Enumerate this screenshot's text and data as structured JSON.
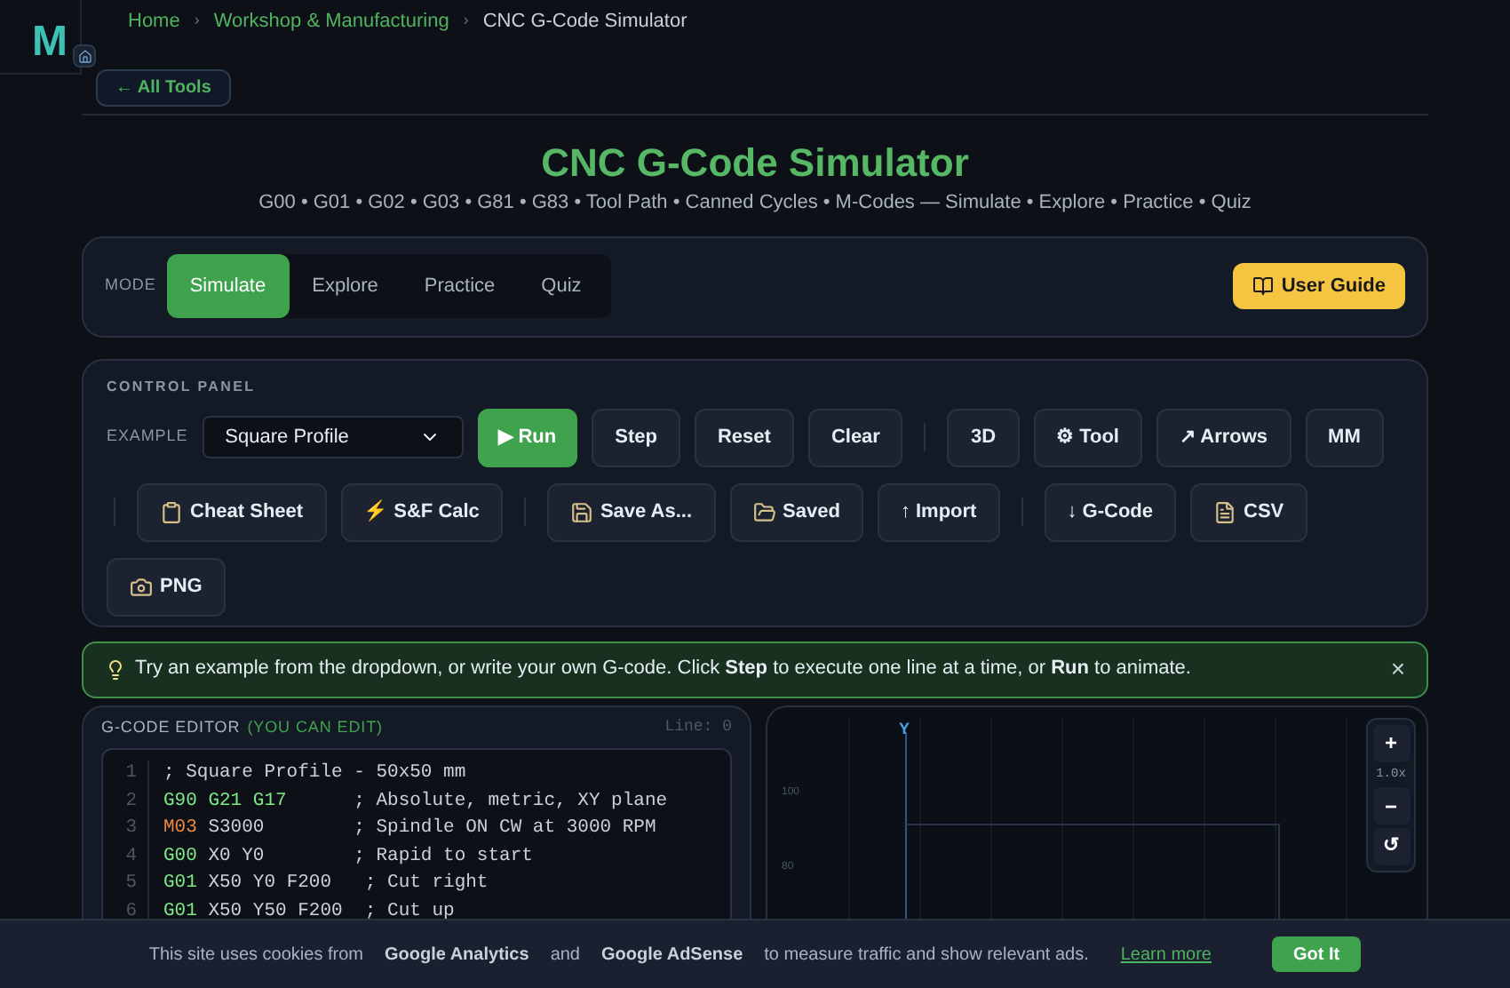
{
  "logo": {
    "letter": "M"
  },
  "breadcrumb": [
    {
      "label": "Home",
      "link": true
    },
    {
      "separator_before": "›",
      "label": "Workshop & Manufacturing",
      "link": true
    },
    {
      "separator_before": "›",
      "label": "CNC G-Code Simulator",
      "link": false
    }
  ],
  "back_button": "← All Tools",
  "title": "CNC G-Code Simulator",
  "subtitle": "G00 • G01 • G02 • G03 • G81 • G83 • Tool Path • Canned Cycles • M-Codes — Simulate • Explore • Practice • Quiz",
  "mode": {
    "label": "MODE",
    "tabs": [
      {
        "label": "Simulate",
        "selected": true
      },
      {
        "label": "Explore",
        "selected": false
      },
      {
        "label": "Practice",
        "selected": false
      },
      {
        "label": "Quiz",
        "selected": false
      }
    ],
    "guide_button": "User Guide"
  },
  "control_panel": {
    "title": "CONTROL PANEL",
    "example_label": "EXAMPLE",
    "example_value": "Square Profile",
    "items": [
      {
        "kind": "button",
        "label": "▶ Run",
        "primary": true
      },
      {
        "kind": "button",
        "label": "Step",
        "primary": false
      },
      {
        "kind": "button",
        "label": "Reset",
        "primary": false
      },
      {
        "kind": "button",
        "label": "Clear",
        "primary": false
      },
      {
        "kind": "divider"
      },
      {
        "kind": "button",
        "label": "3D",
        "primary": false
      },
      {
        "kind": "button",
        "label": "⚙ Tool",
        "primary": false
      },
      {
        "kind": "button",
        "label": "↗ Arrows",
        "primary": false
      },
      {
        "kind": "button",
        "label": "MM",
        "primary": false
      },
      {
        "kind": "divider"
      },
      {
        "kind": "button",
        "label": "Cheat Sheet",
        "primary": false
      },
      {
        "kind": "button",
        "label": "⚡ S&F Calc",
        "primary": false
      },
      {
        "kind": "divider"
      },
      {
        "kind": "button",
        "label": "Save As...",
        "primary": false
      },
      {
        "kind": "button",
        "label": "Saved",
        "primary": false
      },
      {
        "kind": "button",
        "label": "↑ Import",
        "primary": false
      },
      {
        "kind": "divider"
      },
      {
        "kind": "button",
        "label": "↓ G-Code",
        "primary": false
      },
      {
        "kind": "button",
        "label": "CSV",
        "primary": false
      },
      {
        "kind": "button",
        "label": "PNG",
        "primary": false
      }
    ]
  },
  "tip": {
    "text": "Try an example from the dropdown, or write your own G-code. Click **Step** to execute one line at a time, or **Run** to animate.",
    "close": "×"
  },
  "editor": {
    "title": "G-CODE EDITOR",
    "title_note": "(YOU CAN EDIT)",
    "line_indicator": "Line: 0",
    "lines": [
      {
        "number": "1",
        "tokens": [
          {
            "text": "; Square Profile - 50x50 mm",
            "kind": "comment"
          }
        ]
      },
      {
        "number": "2",
        "tokens": [
          {
            "text": "G90 G21 G17",
            "kind": "gcode"
          },
          {
            "text": "      ; Absolute, metric, XY plane",
            "kind": "comment"
          }
        ]
      },
      {
        "number": "3",
        "tokens": [
          {
            "text": "M03",
            "kind": "mcode"
          },
          {
            "text": " S3000        ; Spindle ON CW at 3000 RPM",
            "kind": "plain"
          }
        ]
      },
      {
        "number": "4",
        "tokens": [
          {
            "text": "G00",
            "kind": "gcode"
          },
          {
            "text": " X0 Y0        ; Rapid to start",
            "kind": "plain"
          }
        ]
      },
      {
        "number": "5",
        "tokens": [
          {
            "text": "G01",
            "kind": "gcode"
          },
          {
            "text": " X50 Y0 F200   ; Cut right",
            "kind": "plain"
          }
        ]
      },
      {
        "number": "6",
        "tokens": [
          {
            "text": "G01",
            "kind": "gcode"
          },
          {
            "text": " X50 Y50 F200  ; Cut up",
            "kind": "plain"
          }
        ]
      }
    ]
  },
  "canvas": {
    "axis_label": "Y",
    "ticks": [
      "100",
      "80"
    ],
    "zoom_in": "+",
    "zoom_level": "1.0x",
    "zoom_out": "−",
    "reset": "↺"
  },
  "cookie": {
    "text_parts": [
      {
        "text": "This site uses cookies from",
        "bold": false
      },
      {
        "text": "Google Analytics",
        "bold": true
      },
      {
        "text": "and",
        "bold": false
      },
      {
        "text": "Google AdSense",
        "bold": true
      },
      {
        "text": "to measure traffic and show relevant ads.",
        "bold": false
      }
    ],
    "link": "Learn more",
    "button": "Got It"
  }
}
